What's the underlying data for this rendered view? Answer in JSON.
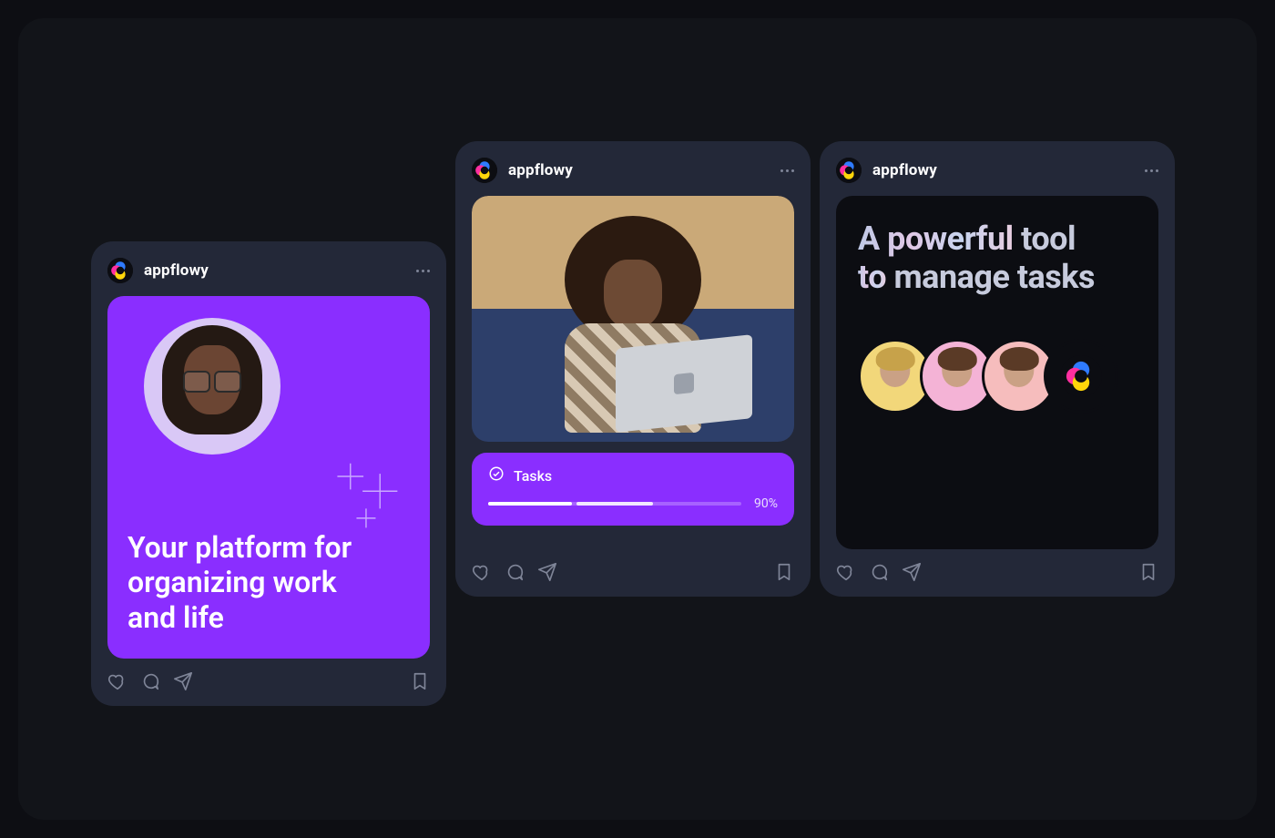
{
  "brand": "appflowy",
  "cards": [
    {
      "headline": "Your platform for organizing work and life"
    },
    {
      "tasks_label": "Tasks",
      "tasks_percent": "90%"
    },
    {
      "headline_grad": "A powerful",
      "headline_rest_1": "tool",
      "headline_grad_2": "to",
      "headline_rest_2": "manage tasks"
    }
  ],
  "colors": {
    "accent": "#8a2eff",
    "card_bg": "#232838",
    "stage_bg": "#121419",
    "page_bg": "#0d0e13"
  }
}
